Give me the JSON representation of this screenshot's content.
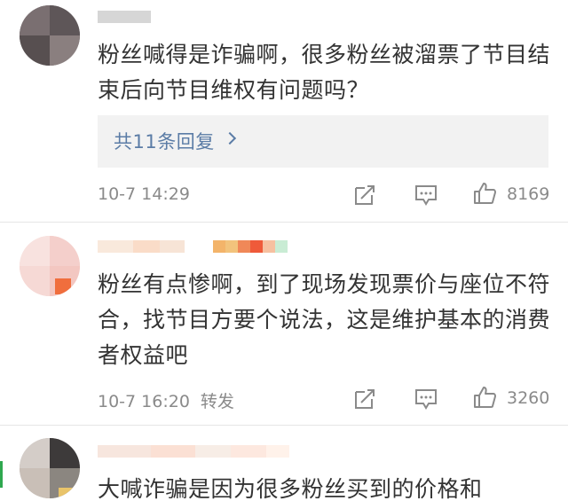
{
  "comments": [
    {
      "text": "粉丝喊得是诈骗啊，很多粉丝被溜票了节目结束后向节目维权有问题吗？",
      "reply_label": "共11条回复",
      "time": "10-7 14:29",
      "forward": "",
      "likes": "8169",
      "icons": [
        "share-icon",
        "comment-icon",
        "like-icon"
      ]
    },
    {
      "text": "粉丝有点惨啊，到了现场发现票价与座位不符合，找节目方要个说法，这是维护基本的消费者权益吧",
      "time": "10-7 16:20",
      "forward": "转发",
      "likes": "3260",
      "icons": [
        "share-icon",
        "comment-icon",
        "like-icon"
      ]
    },
    {
      "text": "大喊诈骗是因为很多粉丝买到的价格和"
    }
  ],
  "colors": {
    "link": "#5b7ca6",
    "meta": "#8a8a8a",
    "reply_bg": "#f2f2f2"
  }
}
